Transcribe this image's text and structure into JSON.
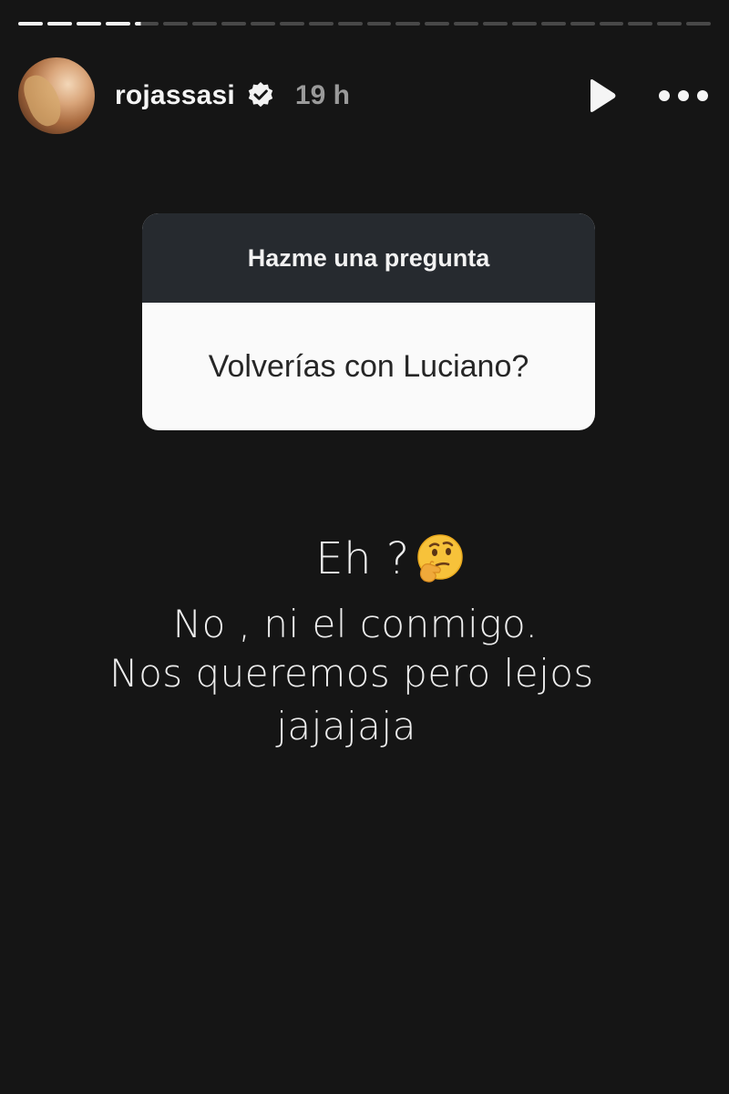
{
  "story": {
    "progress": {
      "segments_total": 24,
      "segments_done": 4,
      "current_segment_progress": 0.25
    },
    "header": {
      "username": "rojassasi",
      "verified": true,
      "timestamp": "19 h",
      "play_icon": "play-icon",
      "more_icon": "more-options-icon"
    },
    "question_sticker": {
      "prompt": "Hazme una pregunta",
      "question": "Volverías con Luciano?"
    },
    "reply": {
      "line1": "Eh ?",
      "emoji_icon": "thinking-face-emoji",
      "line2": "No , ni el conmigo.",
      "line3": "Nos queremos pero lejos",
      "line4": "jajajaja"
    }
  },
  "colors": {
    "background": "#151515",
    "sticker_header": "#262a2f",
    "sticker_body": "#fafafa",
    "text_primary": "#ededed",
    "timestamp": "#9a9a9a"
  }
}
